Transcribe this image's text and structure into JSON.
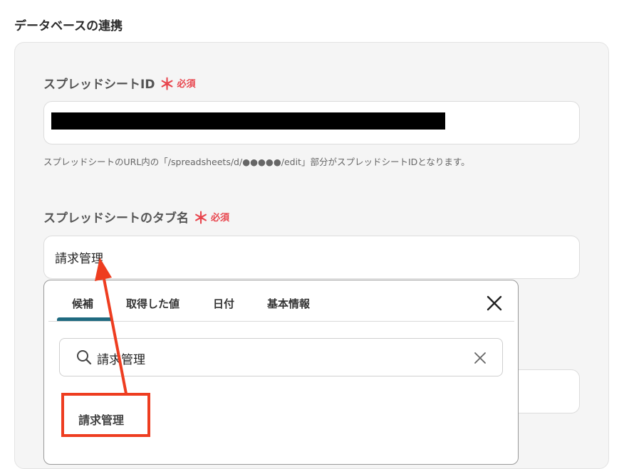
{
  "section": {
    "title": "データベースの連携"
  },
  "spreadsheet_id": {
    "label": "スプレッドシートID",
    "required_mark": "＊",
    "required_text": "必須",
    "helper": "スプレッドシートのURL内の「/spreadsheets/d/●●●●●/edit」部分がスプレッドシートIDとなります。"
  },
  "tab_name": {
    "label": "スプレッドシートのタブ名",
    "required_mark": "＊",
    "required_text": "必須",
    "value": "請求管理"
  },
  "popover": {
    "tabs": [
      "候補",
      "取得した値",
      "日付",
      "基本情報"
    ],
    "active_tab": "候補",
    "search_value": "請求管理",
    "results": [
      "請求管理"
    ]
  },
  "colors": {
    "required": "#e8454d",
    "active_tab_underline": "#1f6a80",
    "annotation": "#ee3d20"
  }
}
